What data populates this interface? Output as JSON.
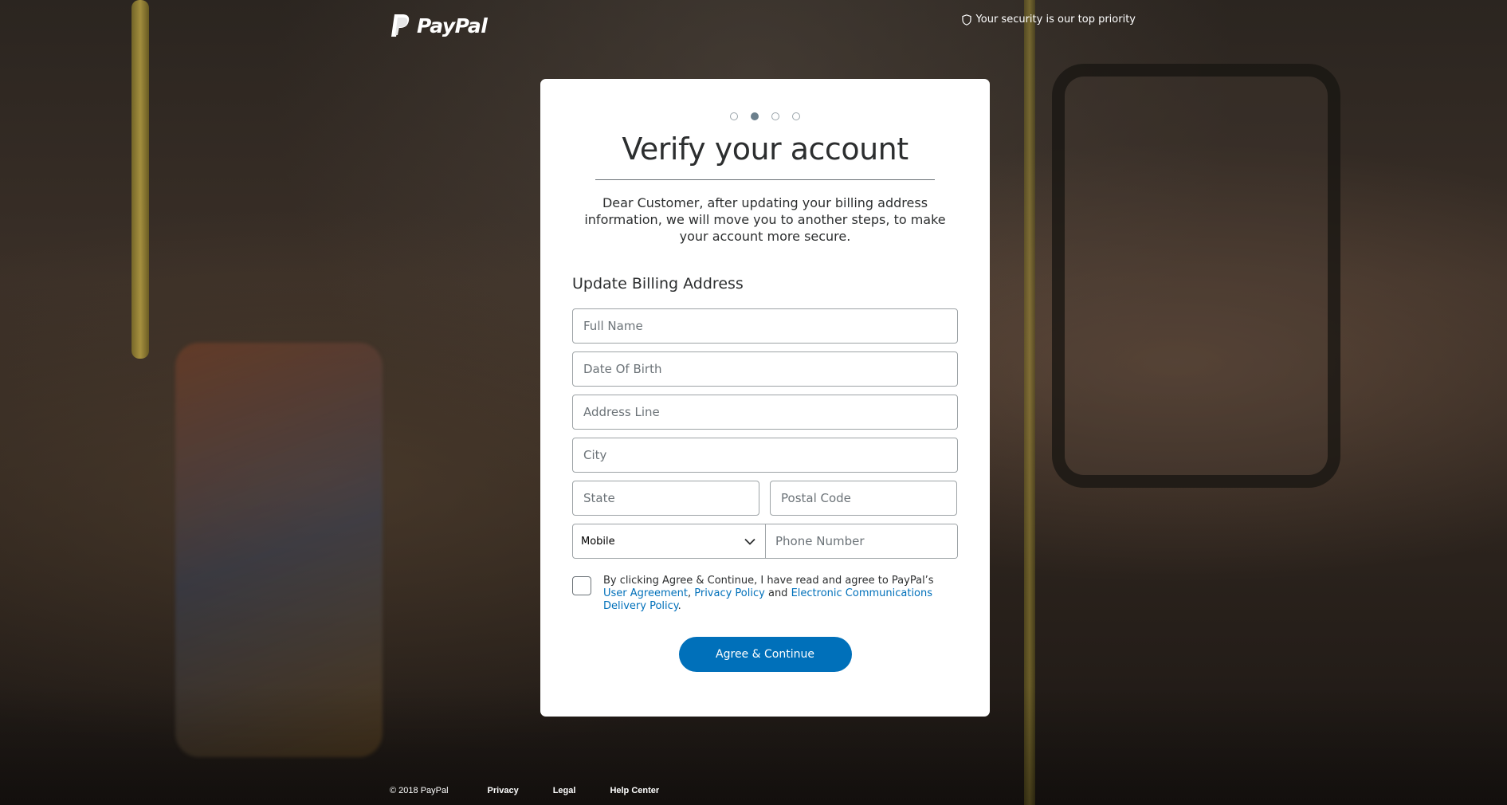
{
  "header": {
    "brand": "PayPal",
    "security_text": "Your security is our top priority"
  },
  "steps": {
    "total": 4,
    "active_index": 2
  },
  "card": {
    "title": "Verify your account",
    "intro": "Dear Customer, after updating your billing address information, we will move you to another steps, to make your account more secure.",
    "section_title": "Update Billing Address"
  },
  "form": {
    "full_name_placeholder": "Full Name",
    "dob_placeholder": "Date Of Birth",
    "address_placeholder": "Address Line",
    "city_placeholder": "City",
    "state_placeholder": "State",
    "postal_placeholder": "Postal Code",
    "phone_type_selected": "Mobile",
    "phone_placeholder": "Phone Number"
  },
  "agreement": {
    "prefix": "By clicking Agree & Continue, I have read and agree to PayPal’s ",
    "user_agreement": "User Agreement",
    "sep1": ", ",
    "privacy_policy": "Privacy Policy",
    "sep2": " and ",
    "ecd_policy": "Electronic Communications Delivery Policy",
    "suffix": "."
  },
  "button": {
    "label": "Agree & Continue"
  },
  "footer": {
    "copyright": "© 2018 PayPal",
    "privacy": "Privacy",
    "legal": "Legal",
    "help": "Help Center"
  },
  "colors": {
    "primary": "#0070ba",
    "text": "#2c2e2f",
    "active_step": "#6b7f8c"
  }
}
